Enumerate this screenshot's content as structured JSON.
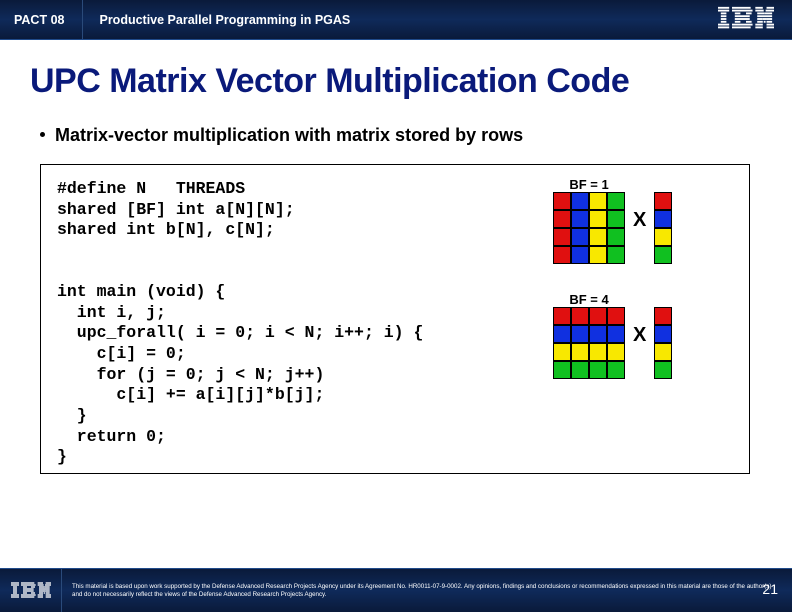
{
  "header": {
    "tab": "PACT 08",
    "title": "Productive Parallel Programming in PGAS"
  },
  "slide": {
    "title": "UPC Matrix Vector Multiplication Code",
    "bullet": "Matrix-vector multiplication with matrix stored by rows"
  },
  "code": "#define N   THREADS\nshared [BF] int a[N][N];\nshared int b[N], c[N];\n\n\nint main (void) {\n  int i, j;\n  upc_forall( i = 0; i < N; i++; i) {\n    c[i] = 0;\n    for (j = 0; j < N; j++)\n      c[i] += a[i][j]*b[j];\n  }\n  return 0;\n}",
  "diagrams": {
    "label_bf1": "BF = 1",
    "label_bf4": "BF = 4",
    "x": "X",
    "matrix_bf1": [
      [
        "r",
        "b",
        "y",
        "g"
      ],
      [
        "r",
        "b",
        "y",
        "g"
      ],
      [
        "r",
        "b",
        "y",
        "g"
      ],
      [
        "r",
        "b",
        "y",
        "g"
      ]
    ],
    "matrix_bf4": [
      [
        "r",
        "r",
        "r",
        "r"
      ],
      [
        "b",
        "b",
        "b",
        "b"
      ],
      [
        "y",
        "y",
        "y",
        "y"
      ],
      [
        "g",
        "g",
        "g",
        "g"
      ]
    ],
    "vector_bf1": [
      "r",
      "b",
      "y",
      "g"
    ],
    "vector_bf4": [
      "r",
      "b",
      "y",
      "g"
    ]
  },
  "footer": {
    "disclaimer": "This material is based upon work supported by the Defense Advanced Research Projects Agency under its Agreement No. HR0011-07-9-0002. Any opinions, findings and conclusions or recommendations expressed in this material are those of the author(s) and do not necessarily reflect the views of the Defense Advanced Research Projects Agency.",
    "page": "21"
  }
}
